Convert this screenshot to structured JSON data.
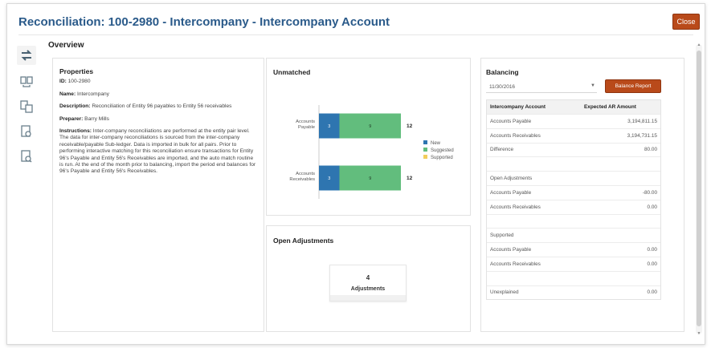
{
  "header": {
    "title": "Reconciliation: 100-2980 - Intercompany - Intercompany Account",
    "close_label": "Close"
  },
  "sidebar": {
    "icons": [
      "reconcile-icon",
      "transactions-icon",
      "match-icon",
      "report-icon",
      "audit-icon"
    ]
  },
  "overview_label": "Overview",
  "properties": {
    "title": "Properties",
    "id_label": "ID:",
    "id_value": "100-2980",
    "name_label": "Name:",
    "name_value": "Intercompany",
    "description_label": "Description:",
    "description_value": "Reconciliation of Entity 96 payables to Entity 56 receivables",
    "preparer_label": "Preparer:",
    "preparer_value": "Barry Mills",
    "instructions_label": "Instructions:",
    "instructions_value": "Inter-company reconciliations are performed at the entity pair level. The data for inter-company reconciliations is sourced from the inter-company receivable/payable Sub-ledger. Data is imported in bulk for all pairs. Prior to performing interactive matching for this reconciliation ensure transactions for Entity 96's Payable and Entity 56's Receivables are imported, and the auto match routine is run. At the end of the month prior to balancing, import the period end balances for 96's Payable and Entity 56's Receivables."
  },
  "unmatched": {
    "title": "Unmatched",
    "chart_data": {
      "type": "bar",
      "orientation": "horizontal",
      "stacked": true,
      "categories": [
        "Accounts Payable",
        "Accounts Receivables"
      ],
      "series": [
        {
          "name": "New",
          "values": [
            3,
            3
          ],
          "color": "#2e75b0"
        },
        {
          "name": "Suggested",
          "values": [
            9,
            9
          ],
          "color": "#62bd7d"
        },
        {
          "name": "Supported",
          "values": [
            0,
            0
          ],
          "color": "#f2cd5c"
        }
      ],
      "totals": [
        12,
        12
      ],
      "xlim": [
        0,
        12
      ],
      "legend": "right"
    }
  },
  "open_adjustments": {
    "title": "Open Adjustments",
    "count": "4",
    "label": "Adjustments"
  },
  "balancing": {
    "title": "Balancing",
    "date": "11/30/2016",
    "report_button": "Balance Report",
    "columns": [
      "Intercompany Account",
      "Expected AR Amount"
    ],
    "rows": [
      {
        "label": "Accounts Payable",
        "value": "3,194,811.15"
      },
      {
        "label": "Accounts Receivables",
        "value": "3,194,731.15"
      },
      {
        "label": "Difference",
        "value": "80.00"
      },
      {
        "label": "",
        "value": ""
      },
      {
        "label": "Open Adjustments",
        "value": ""
      },
      {
        "label": "Accounts Payable",
        "value": "-80.00"
      },
      {
        "label": "Accounts Receivables",
        "value": "0.00"
      },
      {
        "label": "",
        "value": ""
      },
      {
        "label": "Supported",
        "value": ""
      },
      {
        "label": "Accounts Payable",
        "value": "0.00"
      },
      {
        "label": "Accounts Receivables",
        "value": "0.00"
      },
      {
        "label": "",
        "value": ""
      },
      {
        "label": "Unexplained",
        "value": "0.00"
      }
    ]
  }
}
